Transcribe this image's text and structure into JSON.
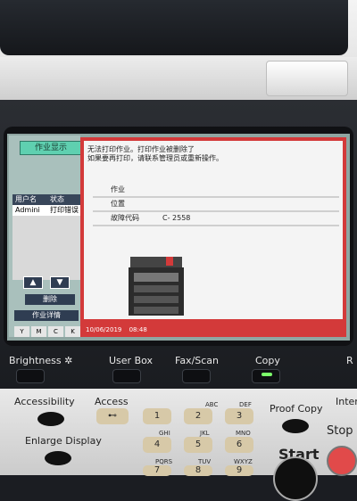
{
  "lcd": {
    "job_button": "作业显示",
    "user_table": {
      "col_user": "用户名",
      "col_status": "状态",
      "row_user": "Admini",
      "row_status": "打印错误"
    },
    "up_arrow": "▲",
    "down_arrow": "▼",
    "delete": "删除",
    "detail": "作业详情",
    "toner": [
      "Y",
      "M",
      "C",
      "K"
    ],
    "message": {
      "line1": "无法打印作业。打印作业被删除了",
      "line2": "如果要再打印，请联系管理员或重新操作。"
    },
    "info": [
      {
        "label": "作业",
        "value": ""
      },
      {
        "label": "位置",
        "value": ""
      },
      {
        "label": "故障代码",
        "value": "C- 2558"
      }
    ],
    "date": "10/06/2019",
    "time": "08:48"
  },
  "panel": {
    "brightness": "Brightness",
    "user_box": "User Box",
    "fax_scan": "Fax/Scan",
    "copy": "Copy",
    "r_cut": "R",
    "accessibility": "Accessibility",
    "access": "Access",
    "proof_copy": "Proof Copy",
    "inter_cut": "Inter",
    "enlarge_display": "Enlarge Display",
    "start": "Start",
    "stop": "Stop",
    "keys": [
      {
        "num": "1",
        "letters": ""
      },
      {
        "num": "2",
        "letters": "ABC"
      },
      {
        "num": "3",
        "letters": "DEF"
      },
      {
        "num": "4",
        "letters": "GHI"
      },
      {
        "num": "5",
        "letters": "JKL"
      },
      {
        "num": "6",
        "letters": "MNO"
      },
      {
        "num": "7",
        "letters": "PQRS"
      },
      {
        "num": "8",
        "letters": "TUV"
      },
      {
        "num": "9",
        "letters": "WXYZ"
      }
    ]
  }
}
